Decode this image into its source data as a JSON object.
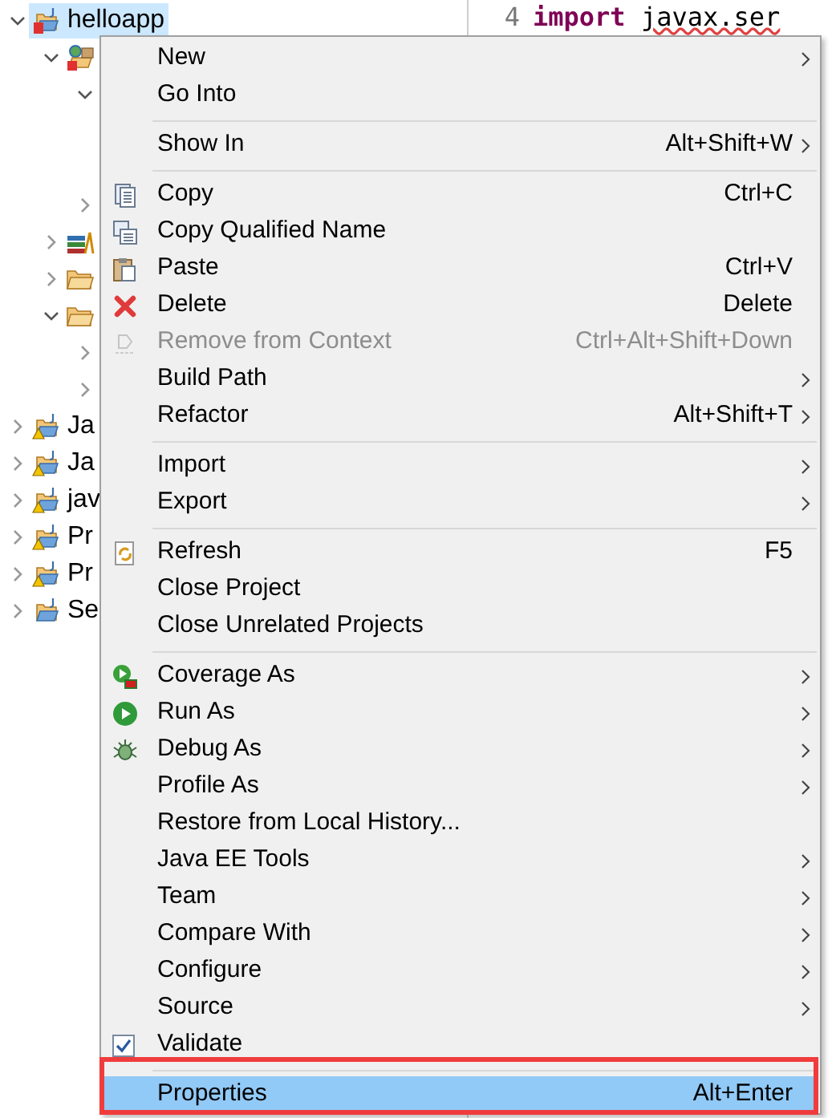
{
  "tree": [
    {
      "label": "helloapp",
      "kind": "errproject",
      "expanded": true,
      "selected": true,
      "children": [
        {
          "kind": "errpackage",
          "expanded": true,
          "selected": false,
          "children": [
            {
              "expanded": true
            },
            {
              "expanded": false
            }
          ]
        },
        {
          "kind": "library",
          "expanded": false,
          "selected": false
        },
        {
          "kind": "folder",
          "expanded": false,
          "selected": false
        },
        {
          "kind": "folder",
          "expanded": true,
          "selected": false,
          "children": [
            {
              "expanded": false
            },
            {
              "expanded": false
            }
          ]
        }
      ]
    },
    {
      "label": "Ja",
      "kind": "warnproject",
      "expanded": false,
      "selected": false
    },
    {
      "label": "Ja",
      "kind": "warnproject",
      "expanded": false,
      "selected": false
    },
    {
      "label": "jav",
      "kind": "warnproject",
      "expanded": false,
      "selected": false
    },
    {
      "label": "Pr",
      "kind": "warnproject",
      "expanded": false,
      "selected": false
    },
    {
      "label": "Pr",
      "kind": "warnproject",
      "expanded": false,
      "selected": false
    },
    {
      "label": "Se",
      "kind": "project",
      "expanded": false,
      "selected": false
    }
  ],
  "editor": {
    "lines": [
      {
        "number": "4",
        "keyword": "import",
        "code": "javax.ser"
      }
    ]
  },
  "menu": {
    "items": [
      {
        "kind": "plain",
        "label": "New",
        "submenu": true,
        "disabled": false,
        "selected": false,
        "framed": false
      },
      {
        "kind": "plain",
        "label": "Go Into",
        "submenu": false,
        "disabled": false,
        "selected": false,
        "framed": false
      },
      {
        "kind": "separator"
      },
      {
        "kind": "plain",
        "label": "Show In",
        "shortcut": "Alt+Shift+W",
        "submenu": true,
        "disabled": false,
        "selected": false,
        "framed": false
      },
      {
        "kind": "separator"
      },
      {
        "kind": "copy",
        "label": "Copy",
        "shortcut": "Ctrl+C",
        "submenu": false,
        "disabled": false,
        "selected": false,
        "framed": false
      },
      {
        "kind": "qualified",
        "label": "Copy Qualified Name",
        "submenu": false,
        "disabled": false,
        "selected": false,
        "framed": false
      },
      {
        "kind": "paste",
        "label": "Paste",
        "shortcut": "Ctrl+V",
        "submenu": false,
        "disabled": false,
        "selected": false,
        "framed": false
      },
      {
        "kind": "delete",
        "label": "Delete",
        "shortcut": "Delete",
        "submenu": false,
        "disabled": false,
        "selected": false,
        "framed": false
      },
      {
        "kind": "remove",
        "label": "Remove from Context",
        "shortcut": "Ctrl+Alt+Shift+Down",
        "submenu": false,
        "disabled": true,
        "selected": false,
        "framed": false
      },
      {
        "kind": "plain",
        "label": "Build Path",
        "submenu": true,
        "disabled": false,
        "selected": false,
        "framed": false
      },
      {
        "kind": "plain",
        "label": "Refactor",
        "shortcut": "Alt+Shift+T",
        "submenu": true,
        "disabled": false,
        "selected": false,
        "framed": false
      },
      {
        "kind": "separator"
      },
      {
        "kind": "plain",
        "label": "Import",
        "submenu": true,
        "disabled": false,
        "selected": false,
        "framed": false
      },
      {
        "kind": "plain",
        "label": "Export",
        "submenu": true,
        "disabled": false,
        "selected": false,
        "framed": false
      },
      {
        "kind": "separator"
      },
      {
        "kind": "refresh",
        "label": "Refresh",
        "shortcut": "F5",
        "submenu": false,
        "disabled": false,
        "selected": false,
        "framed": false
      },
      {
        "kind": "plain",
        "label": "Close Project",
        "submenu": false,
        "disabled": false,
        "selected": false,
        "framed": false
      },
      {
        "kind": "plain",
        "label": "Close Unrelated Projects",
        "submenu": false,
        "disabled": false,
        "selected": false,
        "framed": false
      },
      {
        "kind": "separator"
      },
      {
        "kind": "coverage",
        "label": "Coverage As",
        "submenu": true,
        "disabled": false,
        "selected": false,
        "framed": false
      },
      {
        "kind": "run",
        "label": "Run As",
        "submenu": true,
        "disabled": false,
        "selected": false,
        "framed": false
      },
      {
        "kind": "debug",
        "label": "Debug As",
        "submenu": true,
        "disabled": false,
        "selected": false,
        "framed": false
      },
      {
        "kind": "plain",
        "label": "Profile As",
        "submenu": true,
        "disabled": false,
        "selected": false,
        "framed": false
      },
      {
        "kind": "plain",
        "label": "Restore from Local History...",
        "submenu": false,
        "disabled": false,
        "selected": false,
        "framed": false
      },
      {
        "kind": "plain",
        "label": "Java EE Tools",
        "submenu": true,
        "disabled": false,
        "selected": false,
        "framed": false
      },
      {
        "kind": "plain",
        "label": "Team",
        "submenu": true,
        "disabled": false,
        "selected": false,
        "framed": false
      },
      {
        "kind": "plain",
        "label": "Compare With",
        "submenu": true,
        "disabled": false,
        "selected": false,
        "framed": false
      },
      {
        "kind": "plain",
        "label": "Configure",
        "submenu": true,
        "disabled": false,
        "selected": false,
        "framed": false
      },
      {
        "kind": "plain",
        "label": "Source",
        "submenu": true,
        "disabled": false,
        "selected": false,
        "framed": false
      },
      {
        "kind": "check",
        "label": "Validate",
        "checked": true,
        "submenu": false,
        "disabled": false,
        "selected": false,
        "framed": false
      },
      {
        "kind": "separator"
      },
      {
        "kind": "plain",
        "label": "Properties",
        "shortcut": "Alt+Enter",
        "submenu": false,
        "disabled": false,
        "selected": true,
        "framed": true
      }
    ]
  }
}
